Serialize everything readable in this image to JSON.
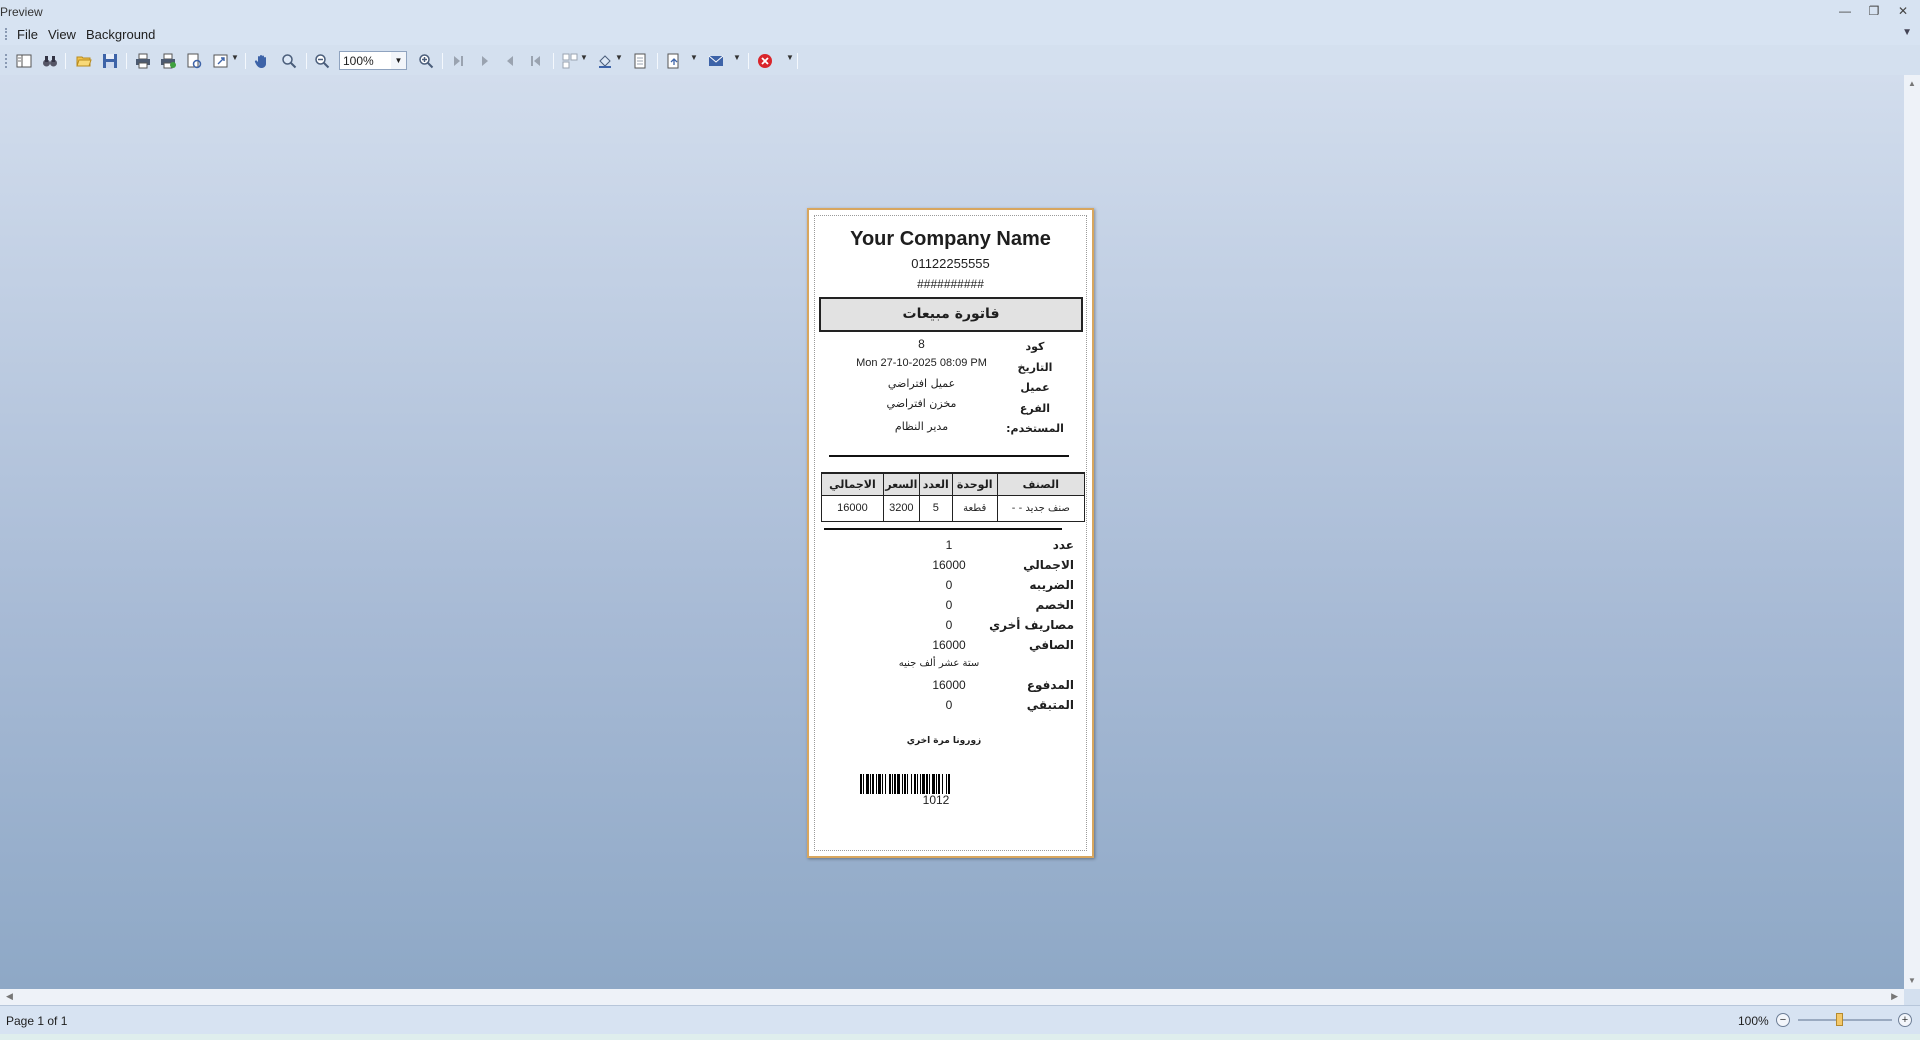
{
  "window": {
    "title": "Preview"
  },
  "menu": {
    "file": "File",
    "view": "View",
    "background": "Background"
  },
  "toolbar": {
    "zoom_value": "100%"
  },
  "status": {
    "page_label": "Page 1 of 1",
    "zoom_label": "100%",
    "zoom_level": 1.0
  },
  "receipt": {
    "company": "Your Company Name",
    "phone": "01122255555",
    "hashes": "##########",
    "doc_title": "فاتورة مبيعات",
    "fields": [
      {
        "label": "كود",
        "value": "8"
      },
      {
        "label": "التاريخ",
        "value": "Mon 27-10-2025 08:09 PM"
      },
      {
        "label": "عميل",
        "value": "عميل افتراضي"
      },
      {
        "label": "الفرع",
        "value": "مخزن افتراضي"
      },
      {
        "label": "المستخدم:",
        "value": "مدير النظام"
      }
    ],
    "table": {
      "headers": [
        "الاجمالي",
        "السعر",
        "العدد",
        "الوحدة",
        "الصنف"
      ],
      "rows": [
        [
          "16000",
          "3200",
          "5",
          "قطعة",
          "صنف جديد - -"
        ]
      ]
    },
    "totals": [
      {
        "label": "عدد",
        "value": "1"
      },
      {
        "label": "الاجمالي",
        "value": "16000"
      },
      {
        "label": "الضريبه",
        "value": "0"
      },
      {
        "label": "الخصم",
        "value": "0"
      },
      {
        "label": "مصاريف أخري",
        "value": "0"
      },
      {
        "label": "الصافي",
        "value": "16000"
      }
    ],
    "amount_words": "ستة عشر ألف جنيه",
    "payment": [
      {
        "label": "المدفوع",
        "value": "16000"
      },
      {
        "label": "المتبقي",
        "value": "0"
      }
    ],
    "thanks": "زورونا مرة اخري",
    "barcode_value": "1012"
  }
}
